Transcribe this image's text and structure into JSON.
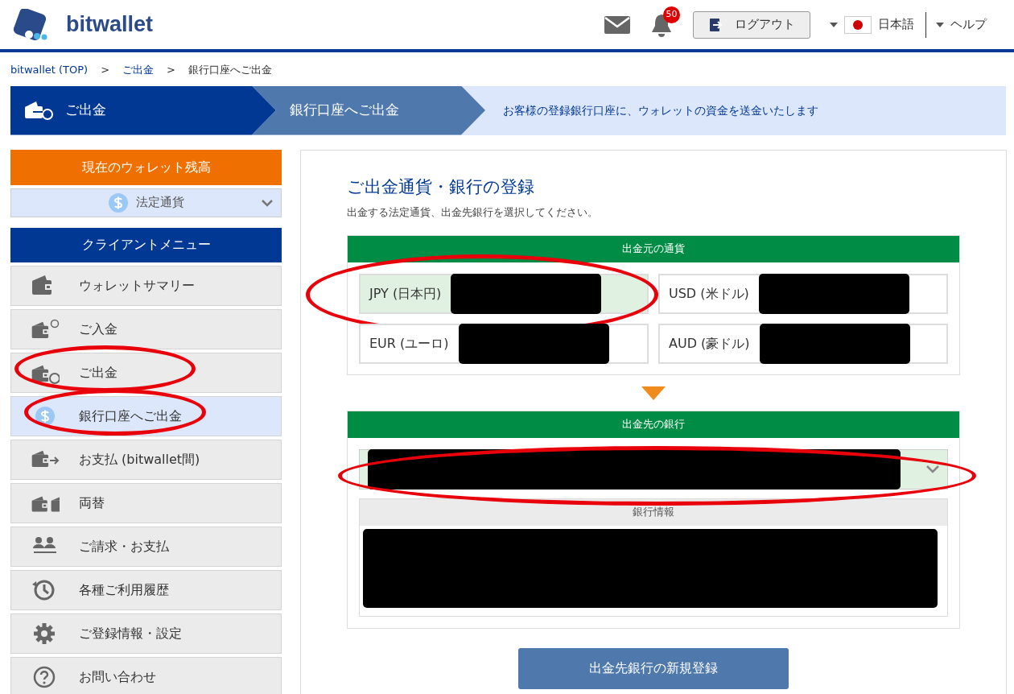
{
  "header": {
    "logo": "bitwallet",
    "notification_count": "50",
    "logout": "ログアウト",
    "language": "日本語",
    "help": "ヘルプ"
  },
  "breadcrumb": [
    {
      "label": "bitwallet (TOP)",
      "link": true
    },
    {
      "label": "ご出金",
      "link": true
    },
    {
      "label": "銀行口座へご出金",
      "link": false
    }
  ],
  "separator": ">",
  "steps": [
    {
      "label": "ご出金",
      "kind": "icon"
    },
    {
      "label": "銀行口座へご出金",
      "kind": "plain"
    }
  ],
  "step_description": "お客様の登録銀行口座に、ウォレットの資金を送金いたします",
  "sidebar": {
    "balance_title": "現在のウォレット残高",
    "balance_select": "法定通貨",
    "menu_title": "クライアントメニュー",
    "items": [
      {
        "label": "ウォレットサマリー",
        "kind": "wallet",
        "selected": false,
        "circled": false
      },
      {
        "label": "ご入金",
        "kind": "deposit",
        "selected": false,
        "circled": false
      },
      {
        "label": "ご出金",
        "kind": "withdraw",
        "selected": false,
        "circled": true
      },
      {
        "label": "銀行口座へご出金",
        "kind": "sub",
        "selected": true,
        "circled": true
      },
      {
        "label": "お支払 (bitwallet間)",
        "kind": "pay",
        "selected": false,
        "circled": false
      },
      {
        "label": "両替",
        "kind": "exchange",
        "selected": false,
        "circled": false
      },
      {
        "label": "ご請求・お支払",
        "kind": "billing",
        "selected": false,
        "circled": false
      },
      {
        "label": "各種ご利用履歴",
        "kind": "history",
        "selected": false,
        "circled": false
      },
      {
        "label": "ご登録情報・設定",
        "kind": "settings",
        "selected": false,
        "circled": false
      },
      {
        "label": "お問い合わせ",
        "kind": "help",
        "selected": false,
        "circled": false
      }
    ]
  },
  "main": {
    "title": "ご出金通貨・銀行の登録",
    "subtitle": "出金する法定通貨、出金先銀行を選択してください。",
    "currency_header": "出金元の通貨",
    "currencies": [
      {
        "label": "JPY (日本円)",
        "selected": true,
        "circled": true
      },
      {
        "label": "USD (米ドル)",
        "selected": false,
        "circled": false
      },
      {
        "label": "EUR (ユーロ)",
        "selected": false,
        "circled": false
      },
      {
        "label": "AUD (豪ドル)",
        "selected": false,
        "circled": false
      }
    ],
    "bank_header": "出金先の銀行",
    "bank_select_circled": true,
    "bank_info_header": "銀行情報",
    "register_button": "出金先銀行の新規登録"
  }
}
